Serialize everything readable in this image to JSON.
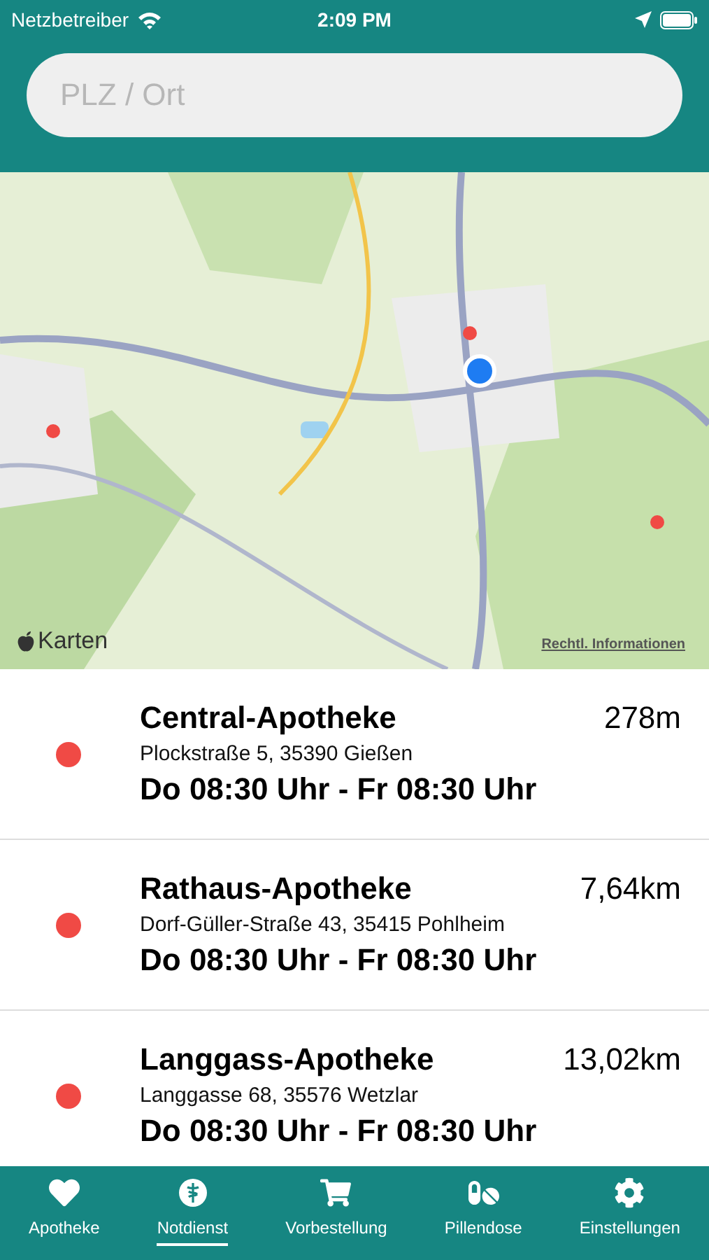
{
  "status_bar": {
    "carrier": "Netzbetreiber",
    "time": "2:09 PM"
  },
  "search": {
    "placeholder": "PLZ / Ort"
  },
  "map": {
    "kind": "picture",
    "attribution": "Karten",
    "legal_link": "Rechtl. Informationen"
  },
  "pharmacies": [
    {
      "name": "Central-Apotheke",
      "distance": "278m",
      "address": "Plockstraße 5, 35390 Gießen",
      "hours": "Do 08:30 Uhr - Fr 08:30 Uhr",
      "color": "#f04a45"
    },
    {
      "name": "Rathaus-Apotheke",
      "distance": "7,64km",
      "address": "Dorf-Güller-Straße 43, 35415 Pohlheim",
      "hours": "Do 08:30 Uhr - Fr 08:30 Uhr",
      "color": "#f04a45"
    },
    {
      "name": "Langgass-Apotheke",
      "distance": "13,02km",
      "address": "Langgasse 68, 35576 Wetzlar",
      "hours": "Do 08:30 Uhr - Fr 08:30 Uhr",
      "color": "#f04a45"
    }
  ],
  "tabs": [
    {
      "label": "Apotheke",
      "kind": "heart",
      "selected": false
    },
    {
      "label": "Notdienst",
      "kind": "caduceus",
      "selected": true
    },
    {
      "label": "Vorbestellung",
      "kind": "cart",
      "selected": false
    },
    {
      "label": "Pillendose",
      "kind": "pills",
      "selected": false
    },
    {
      "label": "Einstellungen",
      "kind": "gear",
      "selected": false
    }
  ]
}
